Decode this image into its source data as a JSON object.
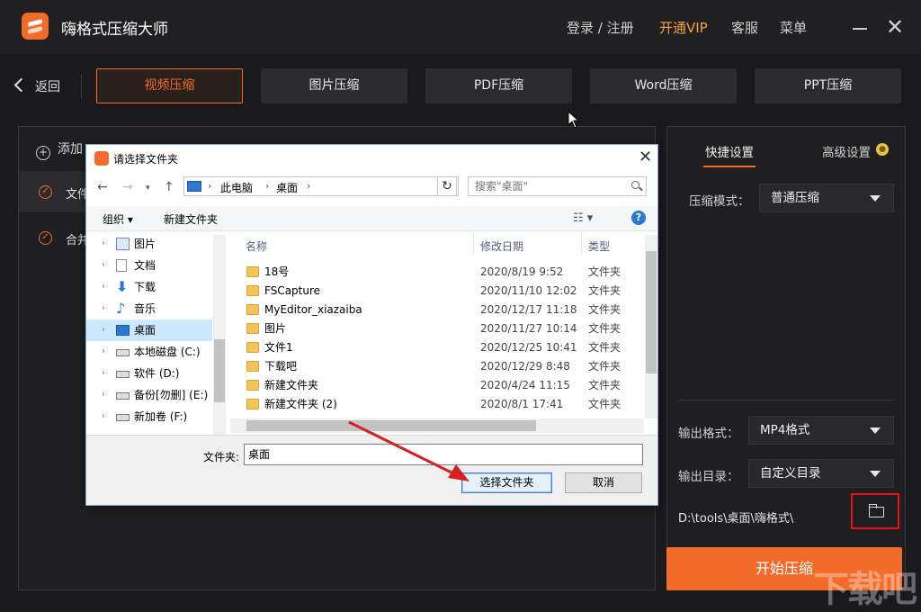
{
  "app": {
    "title": "嗨格式压缩大师",
    "login": "登录 / 注册",
    "vip": "开通VIP",
    "service": "客服",
    "menu": "菜单"
  },
  "nav": {
    "back": "返回",
    "tabs": [
      "视频压缩",
      "图片压缩",
      "PDF压缩",
      "Word压缩",
      "PPT压缩"
    ],
    "active_tab": "视频压缩"
  },
  "left": {
    "add_label": "添加",
    "rows": [
      "文件",
      "合并"
    ]
  },
  "right": {
    "tab_quick": "快捷设置",
    "tab_advanced": "高级设置",
    "mode_label": "压缩模式：",
    "mode_value": "普通压缩",
    "format_label": "输出格式：",
    "format_value": "MP4格式",
    "dir_label": "输出目录：",
    "dir_value": "自定义目录",
    "path": "D:\\tools\\桌面\\嗨格式\\",
    "start": "开始压缩"
  },
  "dialog": {
    "title": "请选择文件夹",
    "breadcrumb": [
      "此电脑",
      "桌面"
    ],
    "search_placeholder": "搜索\"桌面\"",
    "organize": "组织 ▾",
    "new_folder": "新建文件夹",
    "tree": [
      {
        "label": "图片",
        "icon": "pictures-icon"
      },
      {
        "label": "文档",
        "icon": "document-icon"
      },
      {
        "label": "下载",
        "icon": "download-icon"
      },
      {
        "label": "音乐",
        "icon": "music-icon"
      },
      {
        "label": "桌面",
        "icon": "desktop-icon",
        "selected": true
      },
      {
        "label": "本地磁盘 (C:)",
        "icon": "drive-icon"
      },
      {
        "label": "软件 (D:)",
        "icon": "drive-icon"
      },
      {
        "label": "备份[勿删] (E:)",
        "icon": "drive-icon"
      },
      {
        "label": "新加卷 (F:)",
        "icon": "drive-icon"
      }
    ],
    "columns": {
      "name": "名称",
      "date": "修改日期",
      "type": "类型"
    },
    "files": [
      {
        "name": "18号",
        "date": "2020/8/19 9:52",
        "type": "文件夹"
      },
      {
        "name": "FSCapture",
        "date": "2020/11/10 12:02",
        "type": "文件夹"
      },
      {
        "name": "MyEditor_xiazaiba",
        "date": "2020/12/17 11:18",
        "type": "文件夹"
      },
      {
        "name": "图片",
        "date": "2020/11/27 10:14",
        "type": "文件夹"
      },
      {
        "name": "文件1",
        "date": "2020/12/25 10:41",
        "type": "文件夹"
      },
      {
        "name": "下载吧",
        "date": "2020/12/29 8:48",
        "type": "文件夹"
      },
      {
        "name": "新建文件夹",
        "date": "2020/4/24 11:15",
        "type": "文件夹"
      },
      {
        "name": "新建文件夹 (2)",
        "date": "2020/8/1 17:41",
        "type": "文件夹"
      }
    ],
    "folder_label": "文件夹:",
    "folder_value": "桌面",
    "select": "选择文件夹",
    "cancel": "取消"
  },
  "watermark": "下载吧",
  "colors": {
    "accent": "#f26b2a",
    "highlight_box": "#e0151c",
    "arrow": "#d81e1e"
  }
}
